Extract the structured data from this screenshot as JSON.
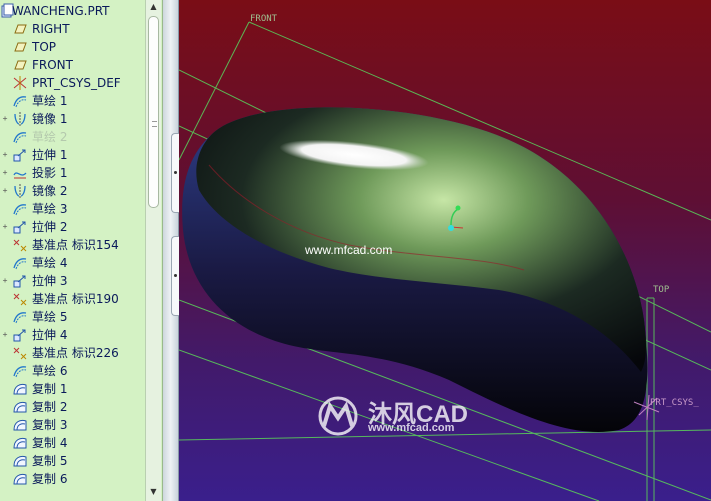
{
  "model_tree": {
    "root_label": "WANCHENG.PRT",
    "items": [
      {
        "label": "RIGHT",
        "icon": "datum-plane-icon",
        "expandable": false,
        "dim": false
      },
      {
        "label": "TOP",
        "icon": "datum-plane-icon",
        "expandable": false,
        "dim": false
      },
      {
        "label": "FRONT",
        "icon": "datum-plane-icon",
        "expandable": false,
        "dim": false
      },
      {
        "label": "PRT_CSYS_DEF",
        "icon": "coordinate-system-icon",
        "expandable": false,
        "dim": false
      },
      {
        "label": "草绘 1",
        "icon": "sketch-icon",
        "expandable": false,
        "dim": false
      },
      {
        "label": "镜像 1",
        "icon": "mirror-icon",
        "expandable": true,
        "dim": false
      },
      {
        "label": "草绘 2",
        "icon": "sketch-icon",
        "expandable": false,
        "dim": true
      },
      {
        "label": "拉伸 1",
        "icon": "extrude-icon",
        "expandable": true,
        "dim": false
      },
      {
        "label": "投影 1",
        "icon": "projection-icon",
        "expandable": true,
        "dim": false
      },
      {
        "label": "镜像 2",
        "icon": "mirror-icon",
        "expandable": true,
        "dim": false
      },
      {
        "label": "草绘 3",
        "icon": "sketch-icon",
        "expandable": false,
        "dim": false
      },
      {
        "label": "拉伸 2",
        "icon": "extrude-icon",
        "expandable": true,
        "dim": false
      },
      {
        "label": "基准点 标识154",
        "icon": "datum-point-icon",
        "expandable": false,
        "dim": false
      },
      {
        "label": "草绘 4",
        "icon": "sketch-icon",
        "expandable": false,
        "dim": false
      },
      {
        "label": "拉伸 3",
        "icon": "extrude-icon",
        "expandable": true,
        "dim": false
      },
      {
        "label": "基准点 标识190",
        "icon": "datum-point-icon",
        "expandable": false,
        "dim": false
      },
      {
        "label": "草绘 5",
        "icon": "sketch-icon",
        "expandable": false,
        "dim": false
      },
      {
        "label": "拉伸 4",
        "icon": "extrude-icon",
        "expandable": true,
        "dim": false
      },
      {
        "label": "基准点 标识226",
        "icon": "datum-point-icon",
        "expandable": false,
        "dim": false
      },
      {
        "label": "草绘 6",
        "icon": "sketch-icon",
        "expandable": false,
        "dim": false
      },
      {
        "label": "复制 1",
        "icon": "copy-surface-icon",
        "expandable": false,
        "dim": false
      },
      {
        "label": "复制 2",
        "icon": "copy-surface-icon",
        "expandable": false,
        "dim": false
      },
      {
        "label": "复制 3",
        "icon": "copy-surface-icon",
        "expandable": false,
        "dim": false
      },
      {
        "label": "复制 4",
        "icon": "copy-surface-icon",
        "expandable": false,
        "dim": false
      },
      {
        "label": "复制 5",
        "icon": "copy-surface-icon",
        "expandable": false,
        "dim": false
      },
      {
        "label": "复制 6",
        "icon": "copy-surface-icon",
        "expandable": false,
        "dim": false
      }
    ]
  },
  "viewport": {
    "datum_front": "FRONT",
    "datum_top": "TOP",
    "datum_csys": "PRT_CSYS_",
    "watermark_url": "www.mfcad.com",
    "logo_text": "沐风CAD",
    "logo_sub": "www.mfcad.com"
  },
  "colors": {
    "tree_background": "#d4f2c4",
    "viewport_top": "#7a0d16",
    "viewport_bottom": "#3a1f8c",
    "datum_lines": "#59c95a"
  }
}
